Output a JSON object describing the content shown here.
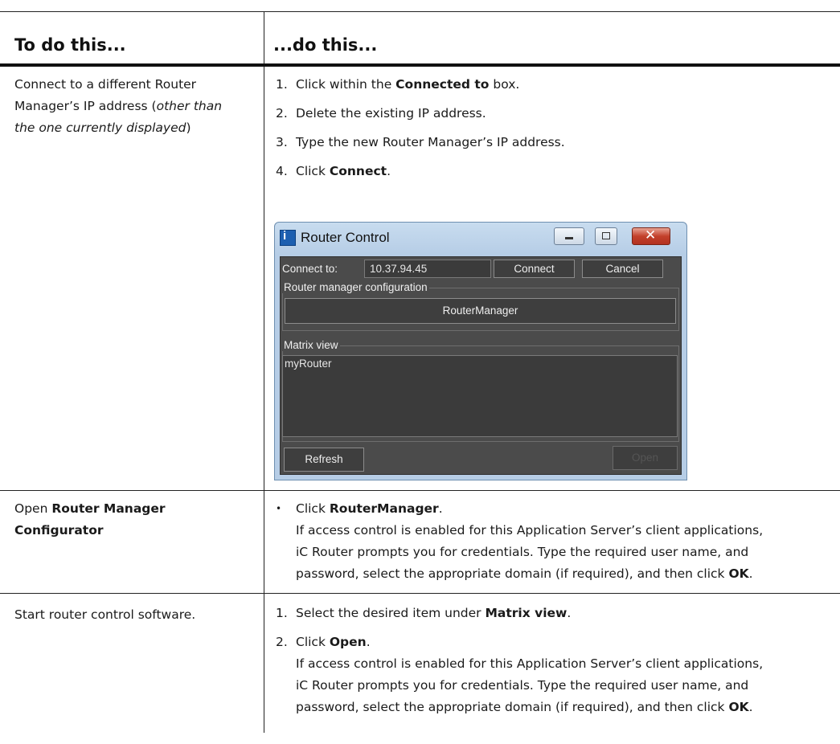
{
  "header": {
    "left": "To do this...",
    "right": "...do this..."
  },
  "row1": {
    "left": {
      "line1": "Connect to a different Router",
      "line2a": "Manager’s IP address (",
      "line2_italic": "other than",
      "line3_italic": "the one currently displayed",
      "line3b": ")"
    },
    "steps": [
      {
        "num": "1.",
        "pre": "Click within the ",
        "bold": "Connected to",
        "post": " box."
      },
      {
        "num": "2.",
        "pre": "Delete the existing IP address.",
        "bold": "",
        "post": ""
      },
      {
        "num": "3.",
        "pre": "Type the new Router Manager’s IP address.",
        "bold": "",
        "post": ""
      },
      {
        "num": "4.",
        "pre": "Click ",
        "bold": "Connect",
        "post": "."
      }
    ]
  },
  "dialog": {
    "title": "Router Control",
    "connect_label": "Connect to:",
    "connect_value": "10.37.94.45",
    "connect_button": "Connect",
    "cancel_button": "Cancel",
    "config_group": "Router manager configuration",
    "config_button": "RouterManager",
    "matrix_group": "Matrix view",
    "matrix_items": [
      "myRouter"
    ],
    "refresh_button": "Refresh",
    "open_button": "Open"
  },
  "row2": {
    "left_pre": "Open ",
    "left_bold1": "Router Manager",
    "left_bold2": "Configurator",
    "bullet": "•",
    "click_pre": "Click ",
    "click_bold": "RouterManager",
    "click_post": ".",
    "para_line1": "If access control is enabled for this Application Server’s client applications,",
    "para_line2": "iC Router prompts you for credentials. Type the required user name, and",
    "para_line3_pre": "password, select the appropriate domain (if required), and then click ",
    "para_line3_bold": "OK",
    "para_line3_post": "."
  },
  "row3": {
    "left": "Start router control software.",
    "step1_num": "1.",
    "step1_pre": "Select the desired item under ",
    "step1_bold": "Matrix view",
    "step1_post": ".",
    "step2_num": "2.",
    "step2_pre": "Click ",
    "step2_bold": "Open",
    "step2_post": ".",
    "para_line1": "If access control is enabled for this Application Server’s client applications,",
    "para_line2": "iC Router prompts you for credentials. Type the required user name, and",
    "para_line3_pre": "password, select the appropriate domain (if required), and then click ",
    "para_line3_bold": "OK",
    "para_line3_post": "."
  }
}
